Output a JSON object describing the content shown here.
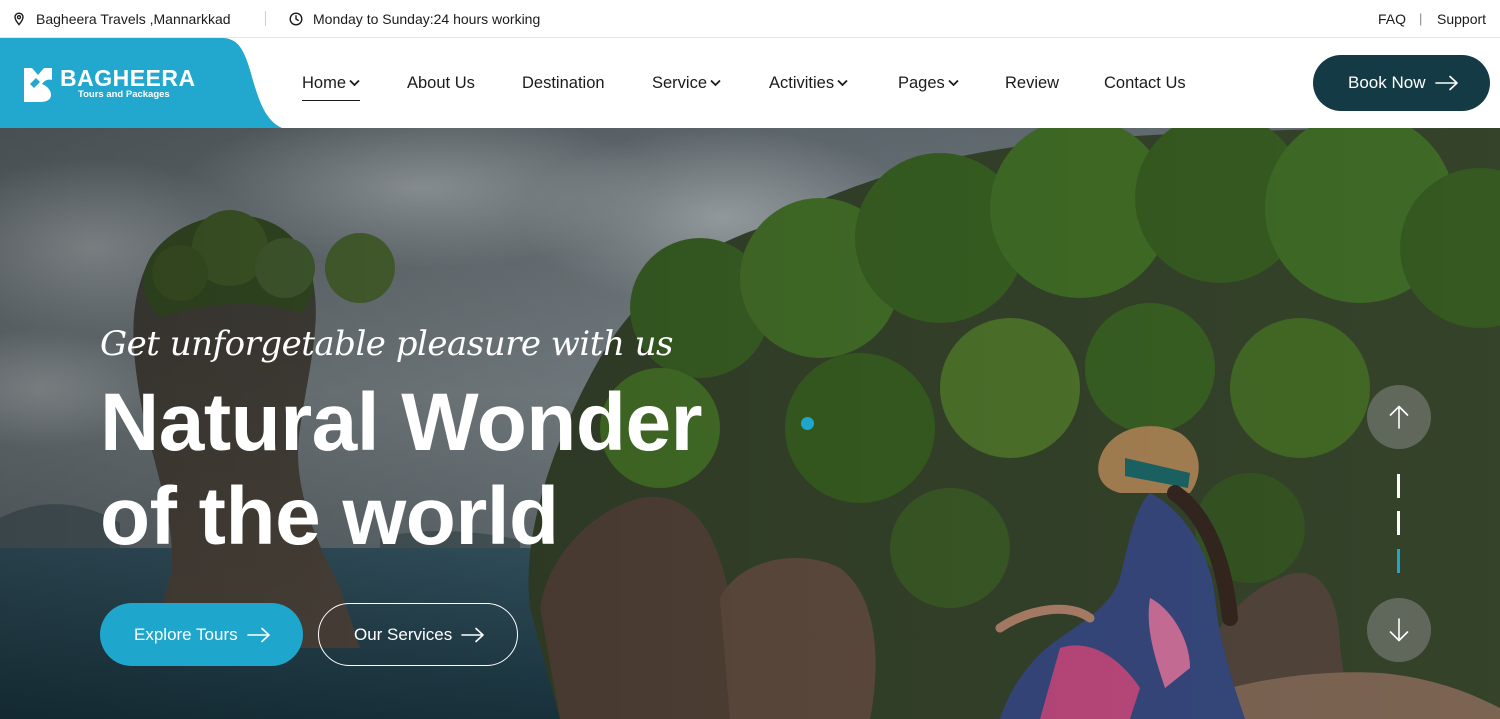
{
  "topbar": {
    "location": "Bagheera Travels ,Mannarkkad",
    "hours": "Monday to Sunday:24 hours working",
    "faq": "FAQ",
    "divider": "|",
    "support": "Support",
    "icons": [
      "map-pin-icon",
      "clock-icon"
    ]
  },
  "brand": {
    "name": "BAGHEERA",
    "tagline": "Tours and Packages",
    "color": "#22a7cf"
  },
  "nav": {
    "items": [
      {
        "label": "Home",
        "dropdown": true,
        "active": true
      },
      {
        "label": "About Us",
        "dropdown": false
      },
      {
        "label": "Destination",
        "dropdown": false
      },
      {
        "label": "Service",
        "dropdown": true
      },
      {
        "label": "Activities",
        "dropdown": true
      },
      {
        "label": "Pages",
        "dropdown": true
      },
      {
        "label": "Review",
        "dropdown": false
      },
      {
        "label": "Contact Us",
        "dropdown": false
      }
    ],
    "book_label": "Book Now",
    "book_color": "#143b45"
  },
  "hero": {
    "subtitle": "Get unforgetable pleasure with us",
    "title_line1": "Natural Wonder",
    "title_line2": "of the world",
    "explore_label": "Explore Tours",
    "services_label": "Our Services",
    "accent": "#1fa6cc",
    "slides_total": 3,
    "active_slide": 3
  }
}
